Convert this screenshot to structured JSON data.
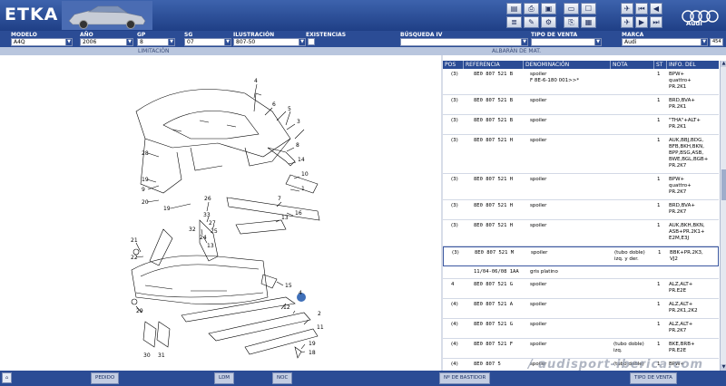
{
  "app": {
    "title": "ETKA",
    "brand_text": "Audi",
    "watermark": "/ audisport-iberica.com"
  },
  "colors": {
    "header": "#2b4c95",
    "accent": "#3b57a0",
    "hotspot": "#3f6fb8"
  },
  "toolbar": {
    "icons": [
      "save-icon",
      "print-icon",
      "image-icon",
      "tools-icon",
      "list-icon",
      "box-icon",
      "pin-icon",
      "nav-icons"
    ]
  },
  "filters": {
    "modelo": {
      "label": "MODELO",
      "value": "A4Q"
    },
    "ano": {
      "label": "AÑO",
      "value": "2006"
    },
    "gp": {
      "label": "GP",
      "value": "8"
    },
    "sg": {
      "label": "SG",
      "value": "07"
    },
    "ilustracion": {
      "label": "ILUSTRACIÓN",
      "value": "807-50"
    },
    "existencias": {
      "label": "EXISTENCIAS"
    },
    "busqueda": {
      "label": "BÚSQUEDA IV",
      "value": ""
    },
    "tipo_venta": {
      "label": "TIPO DE VENTA",
      "value": ""
    },
    "marca": {
      "label": "MARCA",
      "value": "Audi",
      "code": "454"
    }
  },
  "subheader": {
    "limitacion": "LIMITACIÓN",
    "albaran": "ALBARÁN DE MAT."
  },
  "table": {
    "headers": {
      "pos": "POS",
      "ref": "REFERENCIA",
      "den": "DENOMINACIÓN",
      "not": "NOTA",
      "st": "ST",
      "inf": "INFO. DEL MODELO"
    },
    "rows": [
      {
        "pos": "(3)",
        "ref": "8E0 807 521 B",
        "den": "spoiler\nF 8E-6-180 001>>*",
        "not": "",
        "st": "1",
        "inf": "BPW+\nquattro+\nPR.2K1"
      },
      {
        "pos": "(3)",
        "ref": "8E0 807 521 B",
        "den": "spoiler",
        "not": "",
        "st": "1",
        "inf": "BRD,BVA+\nPR.2K1"
      },
      {
        "pos": "(3)",
        "ref": "8E0 807 521 B",
        "den": "spoiler",
        "not": "",
        "st": "1",
        "inf": "\"THA\"+ALT+\nPR.2K1"
      },
      {
        "pos": "(3)",
        "ref": "8E0 807 521 H",
        "den": "spoiler",
        "not": "",
        "st": "1",
        "inf": "AUK,BBJ,BDG,\nBFB,BKH,BKN,\nBPP,BSG,ASB,\nBWE,BGL,BGB+\nPR.2K7"
      },
      {
        "pos": "(3)",
        "ref": "8E0 807 521 H",
        "den": "spoiler",
        "not": "",
        "st": "1",
        "inf": "BPW+\nquattro+\nPR.2K7"
      },
      {
        "pos": "(3)",
        "ref": "8E0 807 521 H",
        "den": "spoiler",
        "not": "",
        "st": "1",
        "inf": "BRD,BVA+\nPR.2K7"
      },
      {
        "pos": "(3)",
        "ref": "8E0 807 521 H",
        "den": "spoiler",
        "not": "",
        "st": "1",
        "inf": "AUK,BKH,BKN,\nASB+PR.2K1+\nE2M,E3J"
      },
      {
        "pos": "(3)",
        "ref": "8E0 807 521 M",
        "den": "spoiler",
        "not": "(tubo doble)\nizq. y der.",
        "st": "1",
        "inf": "BBK+PR.2K3,\nVJ2",
        "selected": true
      },
      {
        "note": true,
        "ref": "11/04-06/08 1AA",
        "den": "gris platino"
      },
      {
        "pos": "4",
        "ref": "8E0 807 521 G",
        "den": "spoiler",
        "not": "",
        "st": "1",
        "inf": "ALZ,ALT+\nPR.E2E"
      },
      {
        "pos": "(4)",
        "ref": "8E0 807 521 A",
        "den": "spoiler",
        "not": "",
        "st": "1",
        "inf": "ALZ,ALT+\nPR.2K1,2K2"
      },
      {
        "pos": "(4)",
        "ref": "8E0 807 521 G",
        "den": "spoiler",
        "not": "",
        "st": "1",
        "inf": "ALZ,ALT+\nPR.2K7"
      },
      {
        "pos": "(4)",
        "ref": "8E0 807 521 F",
        "den": "spoiler",
        "not": "(tubo doble)\nizq.",
        "st": "1",
        "inf": "BKE,BRB+\nPR.E2E"
      },
      {
        "pos": "(4)",
        "ref": "8E0 807 5",
        "den": "spoiler",
        "not": "(tubo doble)",
        "st": "1",
        "inf": "BPW+"
      }
    ]
  },
  "diagram": {
    "callouts": [
      "4",
      "6",
      "5",
      "3",
      "8",
      "14",
      "10",
      "1",
      "7",
      "16",
      "13",
      "28",
      "19",
      "9",
      "20",
      "19",
      "26",
      "32",
      "33",
      "27",
      "25",
      "13",
      "24",
      "21",
      "22",
      "15",
      "12",
      "4",
      "2",
      "11",
      "19",
      "18",
      "29",
      "30",
      "31"
    ]
  },
  "footer": {
    "pedido": "PEDIDO",
    "ldm": "LDM",
    "noc": "NOC",
    "bastidor": "Nº DE BASTIDOR",
    "tipo_venta": "TIPO DE VENTA"
  }
}
